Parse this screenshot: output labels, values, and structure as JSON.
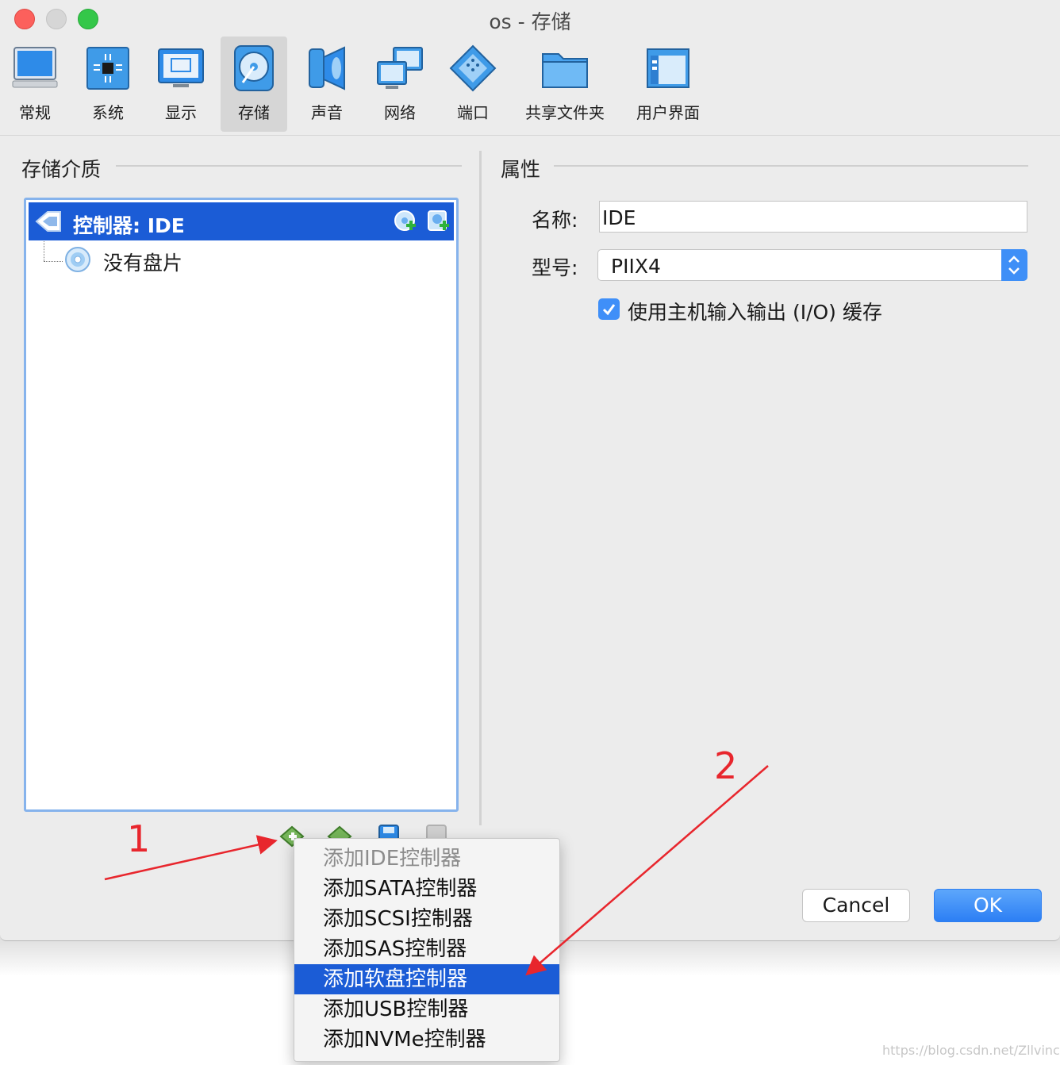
{
  "window": {
    "title": "os  - 存储"
  },
  "toolbar": {
    "items": [
      {
        "label": "常规",
        "icon": "monitor-icon"
      },
      {
        "label": "系统",
        "icon": "chip-icon"
      },
      {
        "label": "显示",
        "icon": "display-icon"
      },
      {
        "label": "存储",
        "icon": "disk-icon",
        "active": true
      },
      {
        "label": "声音",
        "icon": "speaker-icon"
      },
      {
        "label": "网络",
        "icon": "network-icon"
      },
      {
        "label": "端口",
        "icon": "port-icon"
      },
      {
        "label": "共享文件夹",
        "icon": "folder-icon"
      },
      {
        "label": "用户界面",
        "icon": "window-icon"
      }
    ]
  },
  "storage": {
    "section_title": "存储介质",
    "controller_label": "控制器: IDE",
    "disc_label": "没有盘片"
  },
  "properties": {
    "section_title": "属性",
    "name_label": "名称:",
    "name_value": "IDE",
    "type_label": "型号:",
    "type_value": "PIIX4",
    "cache_label": "使用主机输入输出 (I/O) 缓存",
    "cache_checked": true
  },
  "buttons": {
    "cancel": "Cancel",
    "ok": "OK"
  },
  "menu": {
    "items": [
      {
        "label": "添加IDE控制器",
        "disabled": true
      },
      {
        "label": "添加SATA控制器"
      },
      {
        "label": "添加SCSI控制器"
      },
      {
        "label": "添加SAS控制器"
      },
      {
        "label": "添加软盘控制器",
        "highlighted": true
      },
      {
        "label": "添加USB控制器"
      },
      {
        "label": "添加NVMe控制器"
      }
    ]
  },
  "annotations": {
    "marker1": "1",
    "marker2": "2",
    "color": "#e8262d"
  },
  "watermark": "https://blog.csdn.net/Zllvincent",
  "colors": {
    "selection": "#1b5cd6",
    "accent": "#3f8ff8"
  }
}
